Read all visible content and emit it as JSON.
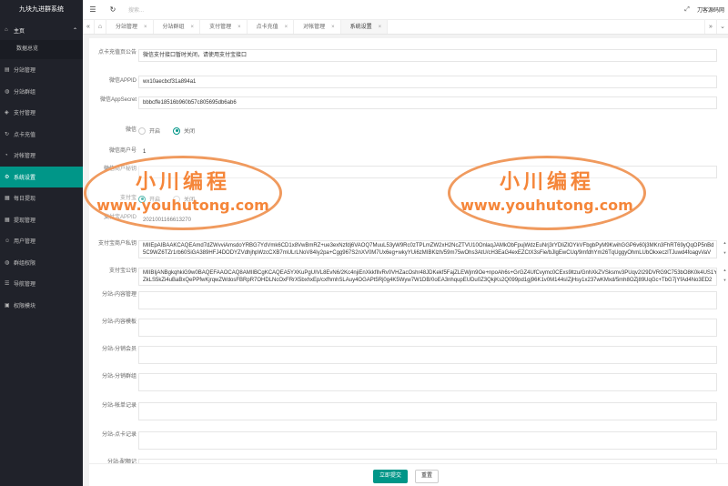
{
  "app": {
    "title": "九块九进群系统"
  },
  "header": {
    "search_placeholder": "搜索...",
    "user": "刀客源码网"
  },
  "sidebar": {
    "home": "主页",
    "home_sub": "数据总览",
    "items": [
      {
        "label": "分站管理",
        "icon": "server-icon"
      },
      {
        "label": "分站群组",
        "icon": "group-icon"
      },
      {
        "label": "支付管理",
        "icon": "cart-icon"
      },
      {
        "label": "点卡充值",
        "icon": "refresh-icon"
      },
      {
        "label": "对帐管理",
        "icon": "chart-icon"
      },
      {
        "label": "系统设置",
        "icon": "gear-icon"
      },
      {
        "label": "每日提现",
        "icon": "calendar-icon"
      },
      {
        "label": "提现管理",
        "icon": "calendar-icon"
      },
      {
        "label": "用户管理",
        "icon": "user-icon"
      },
      {
        "label": "群组权限",
        "icon": "group-icon"
      },
      {
        "label": "导航管理",
        "icon": "list-icon"
      },
      {
        "label": "权限模块",
        "icon": "lock-icon"
      }
    ]
  },
  "tabs": [
    {
      "label": "分站管理"
    },
    {
      "label": "分站群组"
    },
    {
      "label": "支付管理"
    },
    {
      "label": "点卡充值"
    },
    {
      "label": "对帐管理"
    },
    {
      "label": "系统设置",
      "active": true
    }
  ],
  "form": {
    "notice_label": "点卡充值页公告",
    "notice_value": "微信支付接口暂时关闭，请使用支付宝接口",
    "wx_appid_label": "微信APPID",
    "wx_appid_value": "wx10aecbcf31a894a1",
    "wx_secret_label": "微信AppSecret",
    "wx_secret_value": "bbbcffe18516b960b57c805695db6ab6",
    "wx_label": "微信",
    "radio_on": "开启",
    "radio_off": "关闭",
    "mch_id_label": "微信商户号",
    "mch_id_value": "1",
    "mch_key_label": "微信商户秘钥",
    "mch_key_value": "",
    "alipay_label": "支付宝",
    "alipay_radio_on": "开启",
    "alipay_radio_off": "关闭",
    "alipay_appid_label": "支付宝APPID",
    "alipay_appid_value": "2021001166613270",
    "alipay_private_label": "支付宝商户私钥",
    "alipay_private_value": "MIIEpAIBAAKCAQEAmd7dZWvviAmsdoYRBG7YdVmk6CD1x8VwBmRZ+ue3exNzfdj6VAOQ7MuuL53yW9Rc0zTPLmZW2xH2NcZTVU10OnlaqJAMkObFpujWdzEuNrj3rYDliZlOYkVFbgbPyM9KwihGGP6v60j3MKn3FhRT69yQqOP5nBd",
    "alipay_private_value2": "5C9WZ6TZr1rb60SiGA389HFJ4DODYZVdhjhpWzcCXB7mULrLNoV84Iy2pa+Cgg967S2nXV0M7Ux6eg+wkyYUi6zMIBKlzh/59m75wOhs3AtU/cH3EaG4exEZCtX3sFie/bJlgEwCUq/9mfdhYm26TqUggyOhmLUbOkxeczlTJuwd4foagvVaV",
    "alipay_public_label": "支付宝公钥",
    "alipay_public_value": "MIIBIjANBgkqhkiG9w0BAQEFAAOCAQ8AMIIBCgKCAQEA5YXKuPgUIVL8EvN6/2Kc4njiEnXkkfIlvRv0VHZacOshr48JDKekf5FajZLEWjm9Oe+npoAh6s+GrGZ4UfCvymc0CExs9ltzu/GnhXkZVSksmv3PUqv2I29DVRG9C753bO8K0k4US1YfRb",
    "alipay_public_value2": "ZkLS5kZi4uBaBxQePPfwKjrqwZWdosFBRpR7OHDLNcOxFRrX5bxhxEp/cxfhmhSLAuy4OGAPt5Rj0g4K5Wyw7W1DB/0oEA3nhqupEUDu0Z3QkjKs2Q099pd1gj96K1v0M144sIZjHsy1x237wKMxd/5mh8OZj89UqGc+TbG7jYfAd4No3ED2",
    "fz_content_label": "分站-内容管理",
    "fz_template_label": "分站-内容模板",
    "fz_member_label": "分站-分销会员",
    "fz_group_label": "分站-分销群组",
    "fz_bill_label": "分站-帐单记录",
    "fz_card_label": "分站-点卡记录",
    "fz_more_label": "分站-配额记"
  },
  "buttons": {
    "submit": "立即提交",
    "reset": "重置"
  },
  "watermark": {
    "title": "小川编程",
    "url": "www.youhutong.com"
  },
  "colors": {
    "accent": "#009688",
    "sidebar": "#20222a",
    "watermark": "#f5863a"
  }
}
